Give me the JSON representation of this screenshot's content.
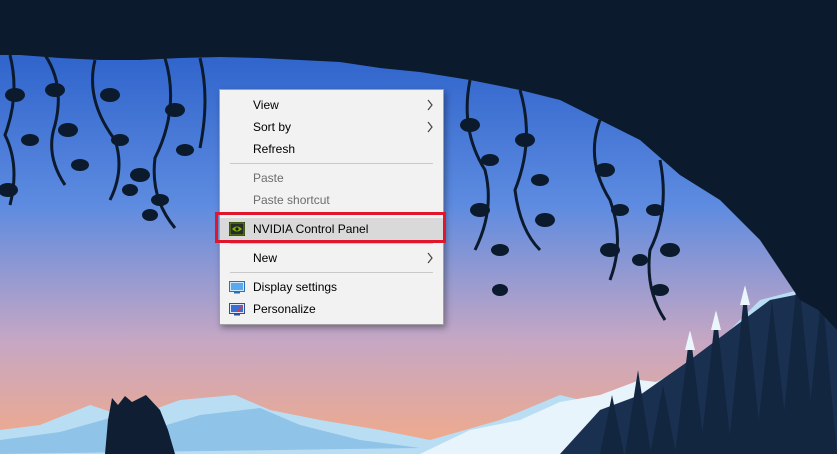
{
  "desktop": {
    "sky_top": "#2f6fd3",
    "sky_bottom": "#f2a98a",
    "cave_color": "#0d1b2e",
    "mountain_light": "#bfe1f5",
    "mountain_dark": "#2a4f78"
  },
  "context_menu": {
    "items": [
      {
        "label": "View",
        "submenu": true,
        "enabled": true
      },
      {
        "label": "Sort by",
        "submenu": true,
        "enabled": true
      },
      {
        "label": "Refresh",
        "submenu": false,
        "enabled": true
      },
      {
        "label": "Paste",
        "submenu": false,
        "enabled": false
      },
      {
        "label": "Paste shortcut",
        "submenu": false,
        "enabled": false
      },
      {
        "label": "NVIDIA Control Panel",
        "icon": "nvidia-icon",
        "enabled": true
      },
      {
        "label": "New",
        "submenu": true,
        "enabled": true
      },
      {
        "label": "Display settings",
        "icon": "display-icon",
        "enabled": true
      },
      {
        "label": "Personalize",
        "icon": "personalize-icon",
        "enabled": true
      }
    ]
  },
  "highlight_color": "#e0162b"
}
